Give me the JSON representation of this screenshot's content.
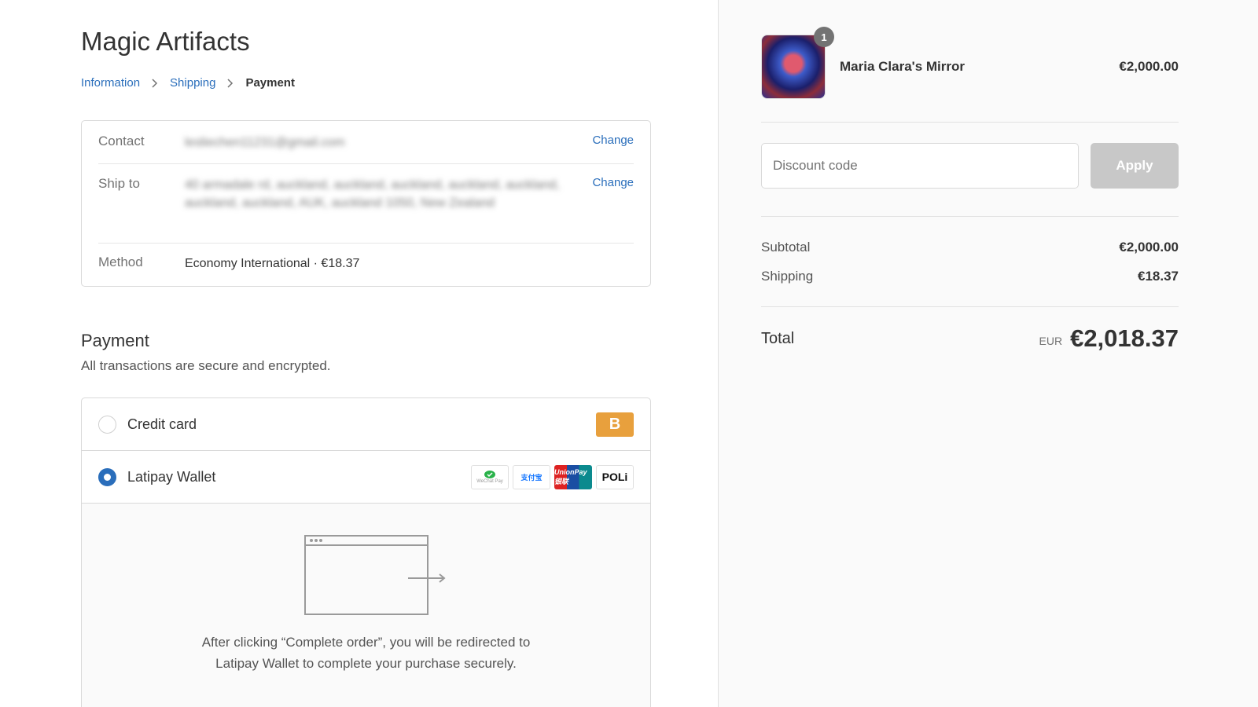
{
  "store": {
    "title": "Magic Artifacts"
  },
  "breadcrumb": {
    "information": "Information",
    "shipping": "Shipping",
    "payment": "Payment"
  },
  "review": {
    "contact_label": "Contact",
    "contact_value": "lesliechen11231@gmail.com",
    "ship_to_label": "Ship to",
    "ship_to_value": "40 armadale rd, auckland, auckland, auckland, auckland, auckland, auckland, auckland, AUK, auckland 1050, New Zealand",
    "method_label": "Method",
    "method_value": "Economy International · €18.37",
    "change_label": "Change"
  },
  "payment": {
    "heading": "Payment",
    "subtitle": "All transactions are secure and encrypted.",
    "credit_card_label": "Credit card",
    "credit_card_badge": "B",
    "latipay_label": "Latipay Wallet",
    "redirect_text_line1": "After clicking “Complete order”, you will be redirected to",
    "redirect_text_line2": "Latipay Wallet to complete your purchase securely.",
    "logos": {
      "wechat": "WeChat Pay",
      "alipay": "支付宝",
      "unionpay": "UnionPay 银联",
      "poli": "POLi"
    }
  },
  "cart": {
    "quantity": "1",
    "product_name": "Maria Clara's Mirror",
    "product_price": "€2,000.00"
  },
  "discount": {
    "placeholder": "Discount code",
    "apply_label": "Apply"
  },
  "summary": {
    "subtotal_label": "Subtotal",
    "subtotal_value": "€2,000.00",
    "shipping_label": "Shipping",
    "shipping_value": "€18.37",
    "total_label": "Total",
    "currency": "EUR",
    "total_value": "€2,018.37"
  },
  "colors": {
    "link": "#2a6ebb",
    "badge": "#e8a03d",
    "button_disabled": "#c8c8c8"
  }
}
